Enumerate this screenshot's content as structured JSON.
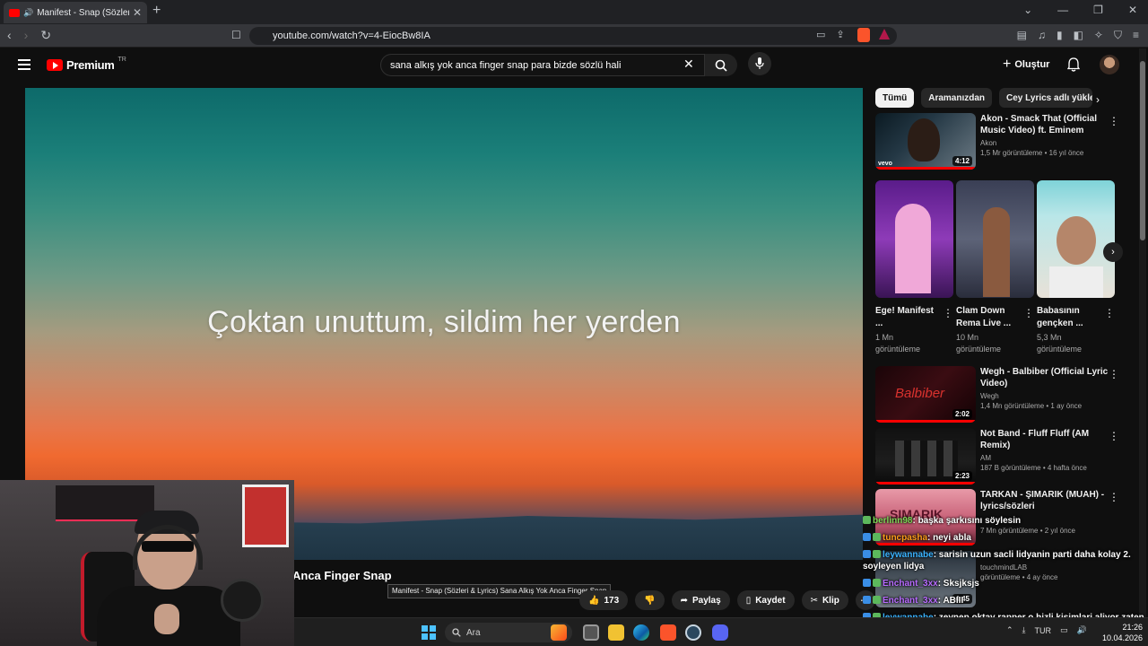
{
  "browser": {
    "tab_title": "Manifest - Snap (Sözleri & Lyrics)",
    "new_tab": "+",
    "url": "youtube.com/watch?v=4-EiocBw8IA",
    "window_controls": [
      "⌄",
      "—",
      "❐",
      "✕"
    ]
  },
  "youtube": {
    "brand": "Premium",
    "country": "TR",
    "search_query": "sana alkış yok anca finger snap para bizde sözlü hali",
    "create_label": "Oluştur"
  },
  "player": {
    "lyric_line": "Çoktan unuttum, sildim her yerden",
    "title_fragment": "Anca Finger Snap",
    "tooltip": "Manifest - Snap (Sözleri & Lyrics) Sana Alkış Yok Anca Finger Snap",
    "likes": "173",
    "share_label": "Paylaş",
    "save_label": "Kaydet",
    "clip_label": "Klip"
  },
  "sidebar": {
    "chips": [
      "Tümü",
      "Aramanızdan",
      "Cey Lyrics adlı yükleyici"
    ],
    "recs_top": [
      {
        "title": "Akon - Smack That (Official Music Video) ft. Eminem",
        "channel": "Akon",
        "meta": "1,5 Mr görüntüleme • 16 yıl önce",
        "duration": "4:12"
      }
    ],
    "shorts": [
      {
        "title": "Ege! Manifest ...",
        "views": "1 Mn görüntüleme"
      },
      {
        "title": "Clam Down Rema Live ...",
        "views": "10 Mn görüntüleme"
      },
      {
        "title": "Babasının gençken ...",
        "views": "5,3 Mn görüntüleme"
      }
    ],
    "recs": [
      {
        "title": "Wegh - Balbiber (Official Lyric Video)",
        "channel": "Wegh",
        "meta": "1,4 Mn görüntüleme • 1 ay önce",
        "duration": "2:02"
      },
      {
        "title": "Not Band - Fluff Fluff (AM Remix)",
        "channel": "AM",
        "meta": "187 B görüntüleme • 4 hafta önce",
        "duration": "2:23"
      },
      {
        "title": "TARKAN - ŞIMARIK (MUAH) - lyrics/sözleri",
        "channel": "",
        "meta": "7 Mn görüntüleme • 2 yıl önce",
        "duration": ""
      },
      {
        "title": "",
        "channel": "touchmindLAB",
        "meta": "görüntüleme • 4 ay önce",
        "duration": "4:45"
      }
    ]
  },
  "chat": [
    {
      "user": "berlinn98",
      "text": ": başka şarkısını söylesin"
    },
    {
      "user": "tuncpasha",
      "text": ": neyi abla"
    },
    {
      "user": "leywannabe",
      "text": ": sarisin uzun sacli lidyanin parti daha kolay 2. soyleyen lidya"
    },
    {
      "user": "Enchant_3xx",
      "text": ": Sksjksjs"
    },
    {
      "user": "Enchant_3xx",
      "text": ": ABIII"
    },
    {
      "user": "leywannabe",
      "text": ": zeynep oktay rapper o hizli kisimlari aliyor zaten"
    }
  ],
  "taskbar": {
    "search_placeholder": "Ara",
    "lang": "TUR",
    "time": "21:26",
    "date": "10.04.2026"
  }
}
